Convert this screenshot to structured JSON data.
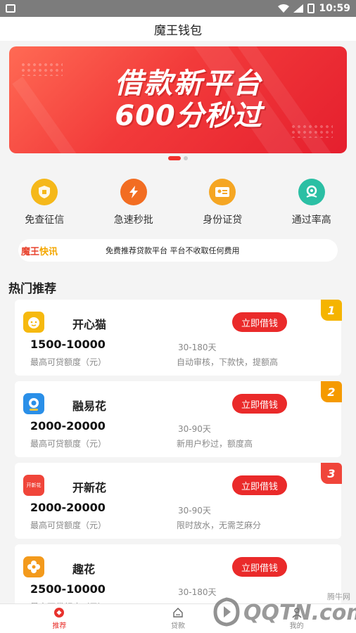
{
  "status_bar": {
    "time": "10:59"
  },
  "header": {
    "title": "魔王钱包"
  },
  "banner": {
    "line1": "借款新平台",
    "line2": "600分秒过"
  },
  "features": [
    {
      "label": "免查征信",
      "icon": "shield-icon",
      "color": "#f5b81a"
    },
    {
      "label": "急速秒批",
      "icon": "lightning-icon",
      "color": "#f26d22"
    },
    {
      "label": "身份证贷",
      "icon": "id-card-icon",
      "color": "#f5a623"
    },
    {
      "label": "通过率高",
      "icon": "location-check-icon",
      "color": "#2bbfa4"
    }
  ],
  "news": {
    "tag_part1": "魔王",
    "tag_part2": "快讯",
    "text": "免费推荐贷款平台 平台不收取任何费用"
  },
  "section_title": "热门推荐",
  "products": [
    {
      "rank": "1",
      "name": "开心猫",
      "button": "立即借钱",
      "amount": "1500-10000",
      "amount_label": "最高可贷额度（元）",
      "term": "30-180天",
      "desc": "自动审核，下款快，提额高",
      "logo_color": "#f6b90f"
    },
    {
      "rank": "2",
      "name": "融易花",
      "button": "立即借钱",
      "amount": "2000-20000",
      "amount_label": "最高可贷额度（元）",
      "term": "30-90天",
      "desc": "新用户秒过，额度高",
      "logo_color": "#2a8fe8"
    },
    {
      "rank": "3",
      "name": "开新花",
      "button": "立即借钱",
      "amount": "2000-20000",
      "amount_label": "最高可贷额度（元）",
      "term": "30-90天",
      "desc": "限时放水，无需芝麻分",
      "logo_color": "#f0453a",
      "logo_text": "开新花"
    },
    {
      "name": "趣花",
      "button": "立即借钱",
      "amount": "2500-10000",
      "amount_label": "最高可贷额度（元）",
      "term": "30-180天",
      "logo_color": "#f39a1c"
    }
  ],
  "bottom_nav": [
    {
      "label": "推荐",
      "icon": "diamond-icon",
      "active": true
    },
    {
      "label": "贷款",
      "icon": "home-icon",
      "active": false
    },
    {
      "label": "我的",
      "icon": "user-icon",
      "active": false
    }
  ],
  "watermark": {
    "text": "QQTN.com",
    "sub": "腾牛网"
  }
}
